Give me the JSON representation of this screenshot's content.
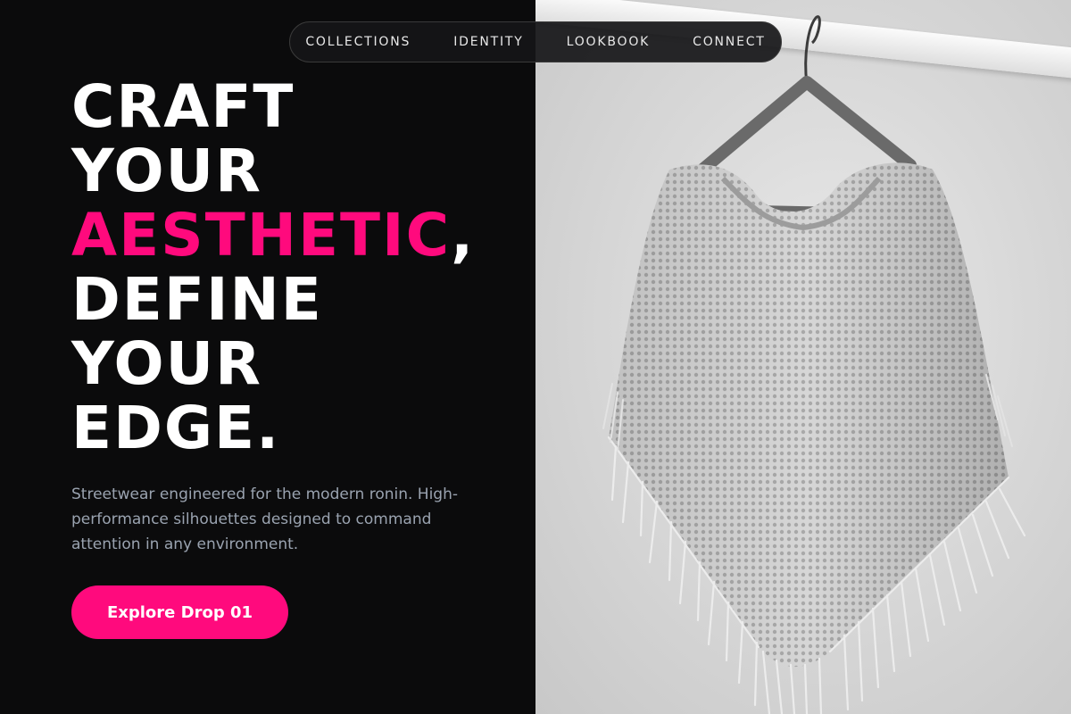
{
  "nav": {
    "items": [
      {
        "label": "COLLECTIONS"
      },
      {
        "label": "IDENTITY"
      },
      {
        "label": "LOOKBOOK"
      },
      {
        "label": "CONNECT"
      }
    ]
  },
  "hero": {
    "headline": {
      "line1": "CRAFT",
      "line2": "YOUR",
      "line3_accent": "AESTHETIC",
      "line3_punct": ",",
      "line4": "DEFINE",
      "line5": "YOUR",
      "line6": "EDGE."
    },
    "subtext": "Streetwear engineered for the modern ronin. High-performance silhouettes designed to command attention in any environment.",
    "cta_label": "Explore Drop 01"
  },
  "image": {
    "subject": "knit-poncho-on-hanger"
  },
  "colors": {
    "background": "#0b0b0c",
    "accent": "#ff0a7d",
    "text_primary": "#ffffff",
    "text_muted": "#9aa3b0"
  }
}
